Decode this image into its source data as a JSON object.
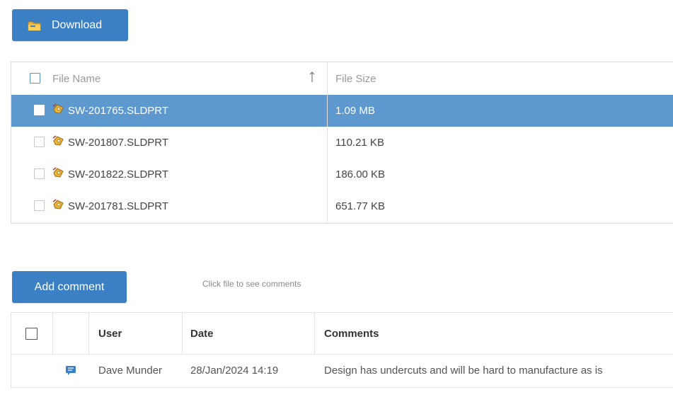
{
  "toolbar": {
    "download_label": "Download"
  },
  "files": {
    "columns": {
      "name": "File Name",
      "size": "File Size"
    },
    "rows": [
      {
        "name": "SW-201765.SLDPRT",
        "size": "1.09 MB",
        "selected": true
      },
      {
        "name": "SW-201807.SLDPRT",
        "size": "110.21 KB",
        "selected": false
      },
      {
        "name": "SW-201822.SLDPRT",
        "size": "186.00 KB",
        "selected": false
      },
      {
        "name": "SW-201781.SLDPRT",
        "size": "651.77 KB",
        "selected": false
      }
    ]
  },
  "comments": {
    "add_label": "Add comment",
    "hint": "Click file to see comments",
    "columns": {
      "user": "User",
      "date": "Date",
      "comments": "Comments"
    },
    "rows": [
      {
        "user": "Dave Munder",
        "date": "28/Jan/2024 14:19",
        "text": "Design has undercuts and will be hard to manufacture as is"
      }
    ]
  },
  "colors": {
    "accent": "#3b7fc4",
    "selected_row": "#5d98cf"
  },
  "icons": {
    "download": "folder-icon",
    "file": "part-icon",
    "sort": "sort-arrow-icon",
    "comment": "comment-icon"
  }
}
